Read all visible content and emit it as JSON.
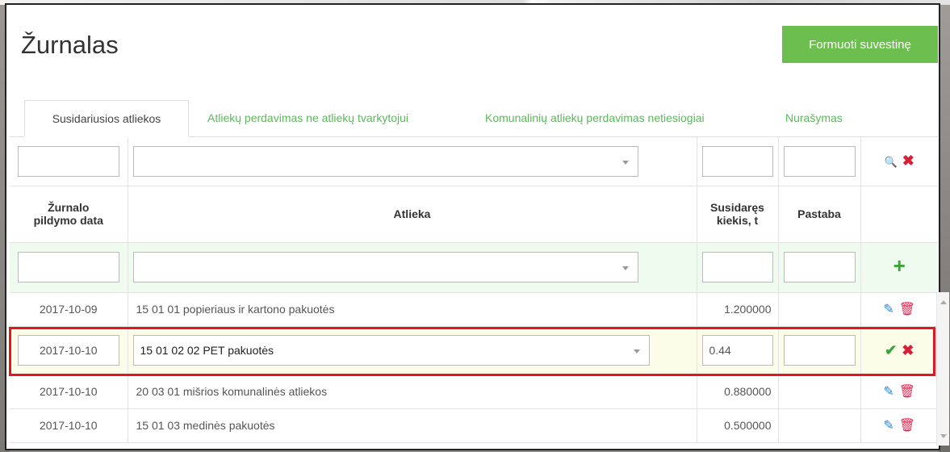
{
  "page": {
    "title": "Žurnalas",
    "generate_button": "Formuoti suvestinę"
  },
  "tabs": [
    {
      "label": "Susidariusios atliekos",
      "active": true
    },
    {
      "label": "Atliekų perdavimas ne atliekų tvarkytojui",
      "active": false
    },
    {
      "label": "Komunalinių atliekų perdavimas netiesiogiai",
      "active": false
    },
    {
      "label": "Nurašymas",
      "active": false
    }
  ],
  "columns": {
    "date_line1": "Žurnalo",
    "date_line2": "pildymo data",
    "waste": "Atlieka",
    "qty_line1": "Susidaręs",
    "qty_line2": "kiekis, t",
    "note": "Pastaba"
  },
  "edit_row": {
    "date": "2017-10-10",
    "waste": "15 01 02 02 PET pakuotės",
    "quantity": "0.44",
    "note": ""
  },
  "rows": [
    {
      "date": "2017-10-09",
      "waste": "15 01 01 popieriaus ir kartono pakuotės",
      "quantity": "1.200000",
      "note": ""
    },
    {
      "date": "2017-10-10",
      "waste": "20 03 01 mišrios komunalinės atliekos",
      "quantity": "0.880000",
      "note": ""
    },
    {
      "date": "2017-10-10",
      "waste": "15 01 03 medinės pakuotės",
      "quantity": "0.500000",
      "note": ""
    }
  ],
  "icons": {
    "search": "magnifier-icon",
    "clear": "x-icon",
    "add": "plus-icon",
    "edit": "pencil-icon",
    "delete": "trash-icon",
    "save": "check-icon",
    "cancel": "x-icon"
  },
  "colors": {
    "accent_green": "#6cbf4f",
    "tab_link": "#5cb85c",
    "highlight_red": "#e2161f",
    "delete_red": "#e0264e",
    "edit_blue": "#2f7fd3"
  }
}
